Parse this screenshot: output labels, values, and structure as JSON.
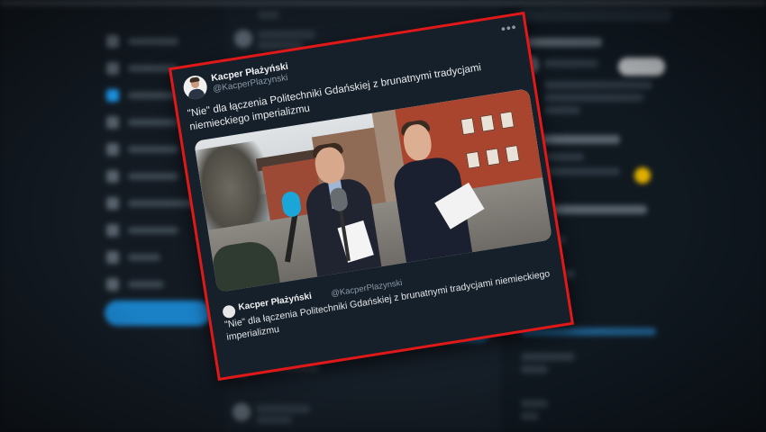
{
  "tweet": {
    "author_name": "Kacper Płażyński",
    "author_handle": "@KacperPlazynski",
    "text": "\"Nie\" dla łączenia Politechniki Gdańskiej z brunatnymi tradycjami niemieckiego imperializmu",
    "more_glyph": "•••"
  },
  "quoted": {
    "author_name": "Kacper Płażyński",
    "author_handle": "@KacperPlazynski",
    "text": "\"Nie\" dla łączenia Politechniki Gdańskiej z brunatnymi tradycjami niemieckiego imperializmu"
  },
  "icons": {
    "more": "more-horizontal-icon"
  },
  "colors": {
    "highlight_border": "#e01818",
    "card_bg": "#15202b",
    "page_bg": "#0f151d",
    "accent": "#1d9bf0"
  }
}
